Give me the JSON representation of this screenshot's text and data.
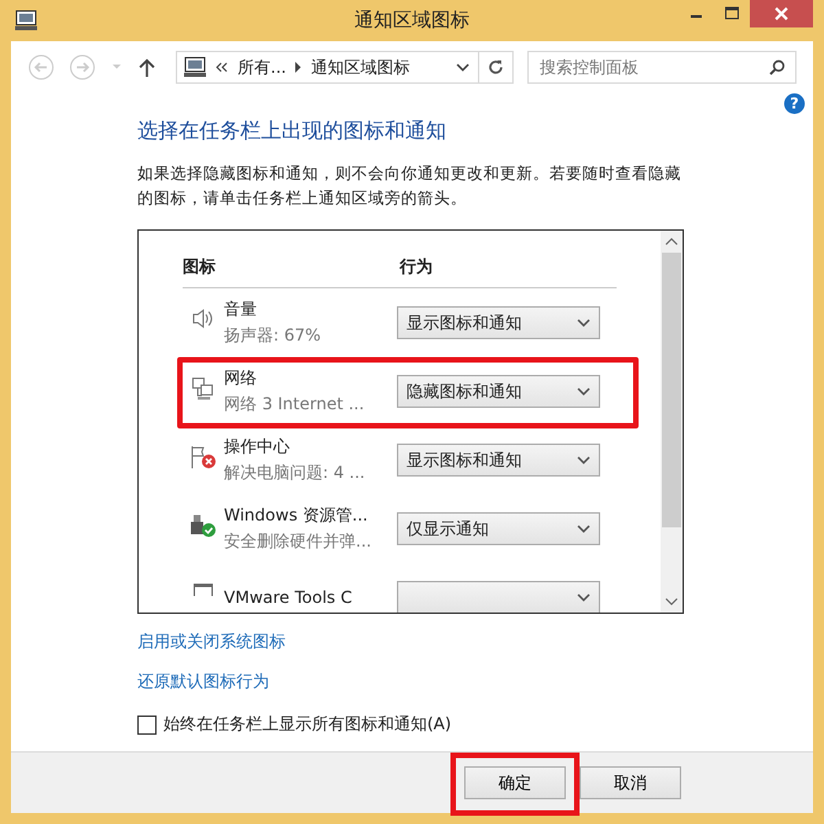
{
  "window": {
    "title": "通知区域图标"
  },
  "address_bar": {
    "crumbs": [
      "所有...",
      "通知区域图标"
    ]
  },
  "search": {
    "placeholder": "搜索控制面板"
  },
  "help": "?",
  "heading": "选择在任务栏上出现的图标和通知",
  "description": "如果选择隐藏图标和通知，则不会向你通知更改和更新。若要随时查看隐藏的图标，请单击任务栏上通知区域旁的箭头。",
  "table": {
    "columns": [
      "图标",
      "行为"
    ],
    "rows": [
      {
        "kind": "speaker",
        "name": "音量",
        "detail": "扬声器: 67%",
        "behavior": "显示图标和通知",
        "highlighted": false
      },
      {
        "kind": "network",
        "name": "网络",
        "detail": "网络  3 Internet ...",
        "behavior": "隐藏图标和通知",
        "highlighted": true
      },
      {
        "kind": "flag",
        "name": "操作中心",
        "detail": "解决电脑问题:  4 ...",
        "behavior": "显示图标和通知",
        "highlighted": false
      },
      {
        "kind": "usb",
        "name": "Windows 资源管...",
        "detail": "安全删除硬件并弹...",
        "behavior": "仅显示通知",
        "highlighted": false
      },
      {
        "kind": "vm",
        "name": "VMware Tools C",
        "highlighted": false
      }
    ]
  },
  "links": [
    "启用或关闭系统图标",
    "还原默认图标行为"
  ],
  "always_show": {
    "label": "始终在任务栏上显示所有图标和通知(A)",
    "checked": false
  },
  "buttons": [
    {
      "label": "确定",
      "highlighted": true
    },
    {
      "label": "取消",
      "highlighted": false
    }
  ]
}
